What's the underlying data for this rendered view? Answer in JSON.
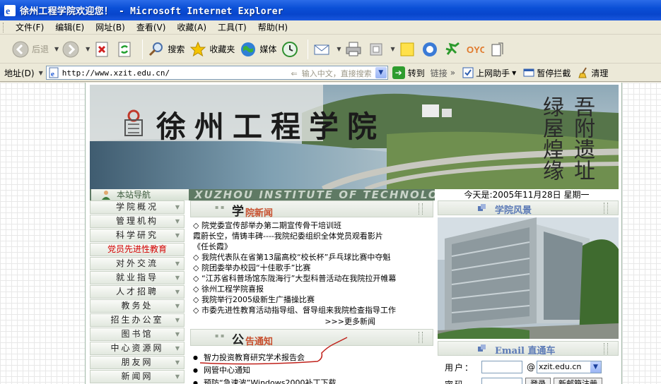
{
  "window": {
    "title": "徐州工程学院欢迎您！ - Microsoft Internet Explorer"
  },
  "menubar": {
    "items": [
      "文件(F)",
      "编辑(E)",
      "网址(B)",
      "查看(V)",
      "收藏(A)",
      "工具(T)",
      "帮助(H)"
    ]
  },
  "toolbar": {
    "back": "后退",
    "search": "搜索",
    "favorites": "收藏夹",
    "media": "媒体"
  },
  "address": {
    "label": "地址(D)",
    "url": "http://www.xzit.edu.cn/",
    "hint": "输入中文，直接搜索",
    "go": "转到",
    "links": "链接",
    "online_helper": "上网助手",
    "popup_block": "暂停拦截",
    "clean": "清理"
  },
  "banner": {
    "school_name": "徐州工程学院",
    "english_name": "XUZHOU INSTITUTE OF TECHNOLOGY",
    "calligraphy": "吾附遗址绿屋煌缘"
  },
  "nav": {
    "title": "本站导航",
    "date": "今天是:2005年11月28日 星期一",
    "items": [
      "学院概况",
      "管理机构",
      "科学研究",
      "党员先进性教育",
      "对外交流",
      "就业指导",
      "人才招聘",
      "教务处",
      "招生办公室",
      "图书馆",
      "中心资源网",
      "朋友网",
      "新闻网"
    ]
  },
  "news": {
    "head_big": "学",
    "head_rest": "院新闻",
    "items": [
      "◇ 院党委宣传部举办第二期宣传骨干培训班",
      "   霞蔚长空，情铸丰碑----我院纪委组织全体党员观看影片",
      "   《任长霞》",
      "◇ 我院代表队在省第13届高校“校长杯”乒乓球比赛中夺魁",
      "◇ 院团委举办校园“十佳歌手”比赛",
      "◇ “江苏省科普场馆东陇海行”大型科普活动在我院拉开帷幕",
      "◇ 徐州工程学院喜报",
      "◇ 我院举行2005级新生广播操比赛",
      "◇ 市委先进性教育活动指导组、督导组来我院检查指导工作"
    ],
    "more": ">>>更多新闻"
  },
  "notice": {
    "head_big": "公",
    "head_rest": "告通知",
    "items": [
      "智力投资教育研究学术报告会",
      "网管中心通知",
      "预防“急速波”Windows2000补丁下载"
    ]
  },
  "scenery": {
    "title": "学院风景"
  },
  "email": {
    "title": "Email 直通车",
    "user_label": "用户：",
    "at": "@",
    "domain": "xzit.edu.cn",
    "password_label": "密码",
    "login": "登录",
    "register": "新邮箱注册"
  }
}
